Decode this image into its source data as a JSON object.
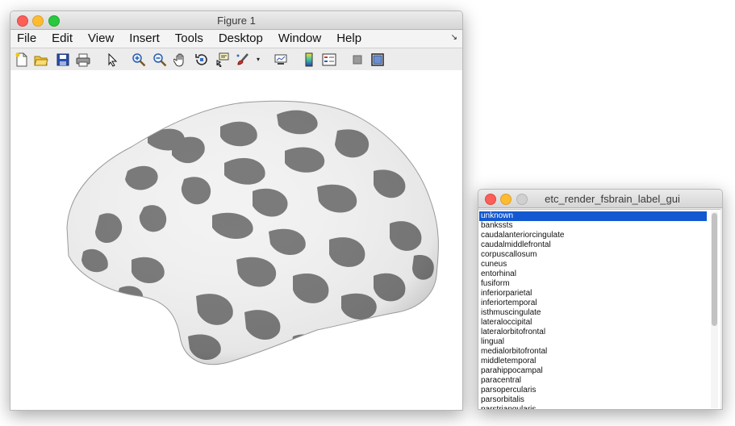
{
  "figure": {
    "title": "Figure 1",
    "menu": [
      "File",
      "Edit",
      "View",
      "Insert",
      "Tools",
      "Desktop",
      "Window",
      "Help"
    ],
    "menu_corner": "↘",
    "toolbar": [
      {
        "icon": "new-figure-icon"
      },
      {
        "icon": "open-file-icon"
      },
      {
        "icon": "save-icon"
      },
      {
        "icon": "print-icon"
      },
      {
        "icon": "pointer-icon"
      },
      {
        "icon": "zoom-in-icon"
      },
      {
        "icon": "zoom-out-icon"
      },
      {
        "icon": "pan-icon"
      },
      {
        "icon": "rotate-3d-icon"
      },
      {
        "icon": "data-cursor-icon"
      },
      {
        "icon": "brush-icon"
      },
      {
        "icon": "link-plot-icon"
      },
      {
        "icon": "colorbar-icon"
      },
      {
        "icon": "legend-icon"
      },
      {
        "icon": "hide-plot-tools-icon"
      },
      {
        "icon": "show-plot-tools-icon"
      }
    ],
    "brush_dropdown": "▾"
  },
  "label_gui": {
    "title": "etc_render_fsbrain_label_gui",
    "selected_index": 0,
    "labels": [
      "unknown",
      "bankssts",
      "caudalanteriorcingulate",
      "caudalmiddlefrontal",
      "corpuscallosum",
      "cuneus",
      "entorhinal",
      "fusiform",
      "inferiorparietal",
      "inferiortemporal",
      "isthmuscingulate",
      "lateraloccipital",
      "lateralorbitofrontal",
      "lingual",
      "medialorbitofrontal",
      "middletemporal",
      "parahippocampal",
      "paracentral",
      "parsopercularis",
      "parsorbitalis",
      "parstriangularis"
    ]
  },
  "colors": {
    "selection": "#1358d0",
    "brain_sulci": "#7a7a7a",
    "brain_gyri": "#f2f2f2"
  }
}
